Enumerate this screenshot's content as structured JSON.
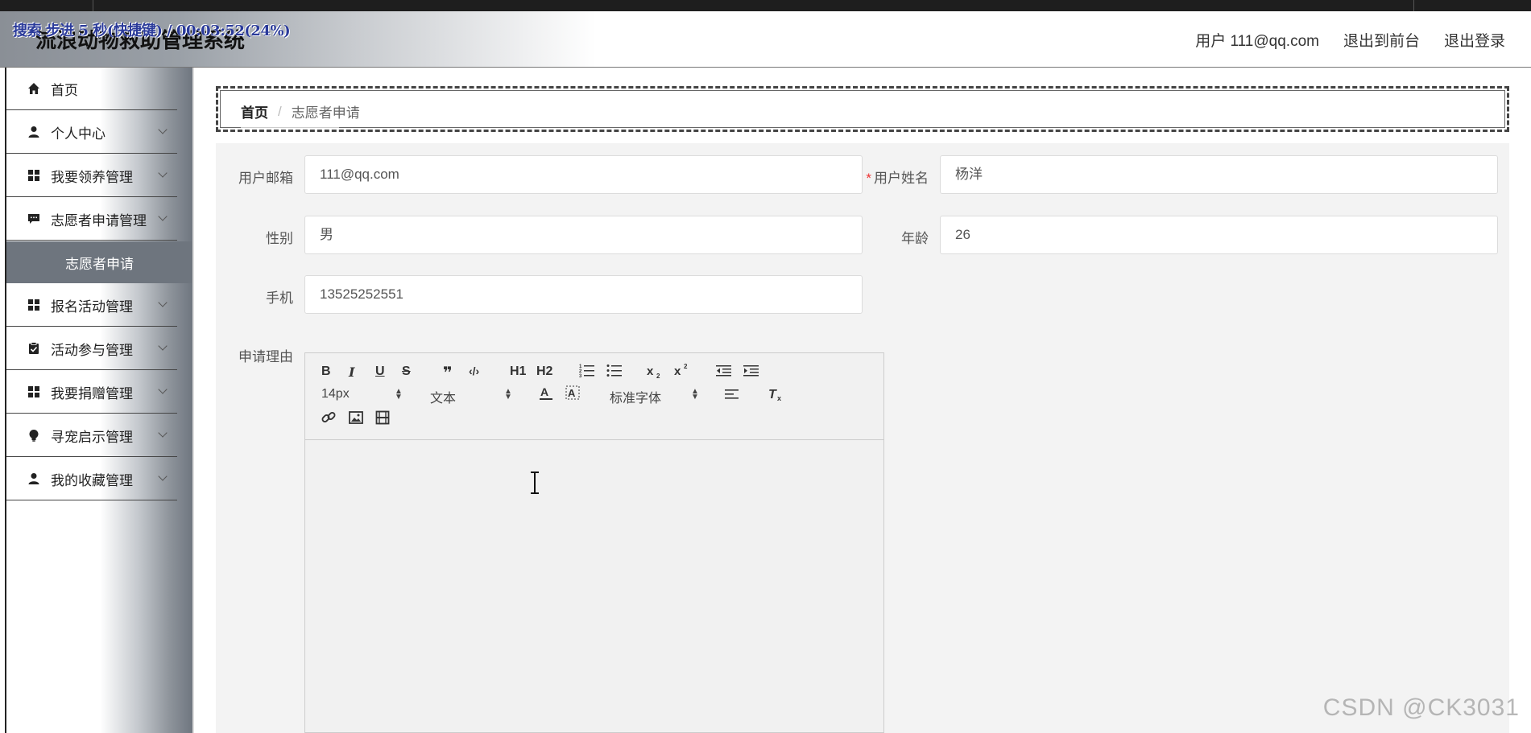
{
  "header": {
    "app_title": "流浪动物救助管理系统",
    "recording_overlay": "搜索 步进 5 秒(快捷键) / 00:03:52(24%)",
    "user_label": "用户 111@qq.com",
    "exit_front_label": "退出到前台",
    "logout_label": "退出登录"
  },
  "sidebar": {
    "items": [
      {
        "label": "首页",
        "icon": "home-icon"
      },
      {
        "label": "个人中心",
        "icon": "person-icon"
      },
      {
        "label": "我要领养管理",
        "icon": "grid-icon"
      },
      {
        "label": "志愿者申请管理",
        "icon": "chat-icon"
      },
      {
        "label": "报名活动管理",
        "icon": "grid-icon"
      },
      {
        "label": "活动参与管理",
        "icon": "clipboard-icon"
      },
      {
        "label": "我要捐赠管理",
        "icon": "grid-icon"
      },
      {
        "label": "寻宠启示管理",
        "icon": "bulb-icon"
      },
      {
        "label": "我的收藏管理",
        "icon": "person-icon"
      }
    ],
    "active_sub": "志愿者申请"
  },
  "breadcrumb": {
    "home": "首页",
    "separator": "/",
    "current": "志愿者申请"
  },
  "form": {
    "email_label": "用户邮箱",
    "email_value": "111@qq.com",
    "name_label": "用户姓名",
    "name_value": "杨洋",
    "gender_label": "性别",
    "gender_value": "男",
    "age_label": "年龄",
    "age_value": "26",
    "phone_label": "手机",
    "phone_value": "13525252551",
    "reason_label": "申请理由",
    "required_mark": "*"
  },
  "editor": {
    "font_size": "14px",
    "block_type": "文本",
    "font_family": "标准字体",
    "tools": [
      "B",
      "I",
      "U",
      "S",
      "❞",
      "‹/›",
      "H1",
      "H2"
    ]
  },
  "watermark": "CSDN @CK3031",
  "colors": {
    "sidebar_active": "#6e757e",
    "form_bg": "#f3f3f3",
    "required": "#e33333"
  }
}
